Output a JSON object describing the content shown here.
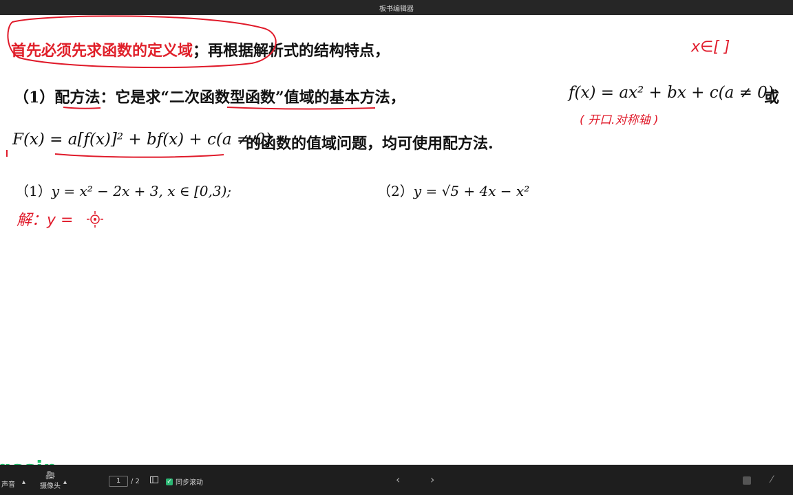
{
  "window": {
    "title": "板书编辑器"
  },
  "content": {
    "line1_red": "首先必须先求函数的定义域",
    "line1_rest": "；再根据解析式的结构特点，",
    "line2_prefix": "（1）",
    "line2_method": "配方法",
    "line2_mid": "：它是求“",
    "line2_quote": "二次函数型函数",
    "line2_after": "”值域的基本方法，",
    "line2_formula": "f(x) = ax² + bx + c(a ≠ 0)",
    "line2_or": "或",
    "line3_formula": "F(x) = a[f(x)]² + bf(x) + c(a ≠ 0)",
    "line3_rest": "的函数的值域问题，均可使用配方法.",
    "ex1_label": "（1）",
    "ex1_formula": "y = x² − 2x + 3, x ∈ [0,3);",
    "ex2_label": "（2）",
    "ex2_formula": "y = √5 + 4x − x²"
  },
  "handwriting": {
    "domain_note": "x∈[   ]",
    "axis_note": "( 开口.对称轴 )",
    "solution": "解：y ="
  },
  "bottom_bar": {
    "sound_label": "声音",
    "camera_label": "摄像头",
    "page_current": "1",
    "page_total": "/ 2",
    "sync_scroll_label": "同步滚动",
    "logo_text": "qssin"
  },
  "colors": {
    "accent_red": "#e0202a",
    "highlight_yellow": "#fff200",
    "logo_green": "#1fc26b"
  }
}
